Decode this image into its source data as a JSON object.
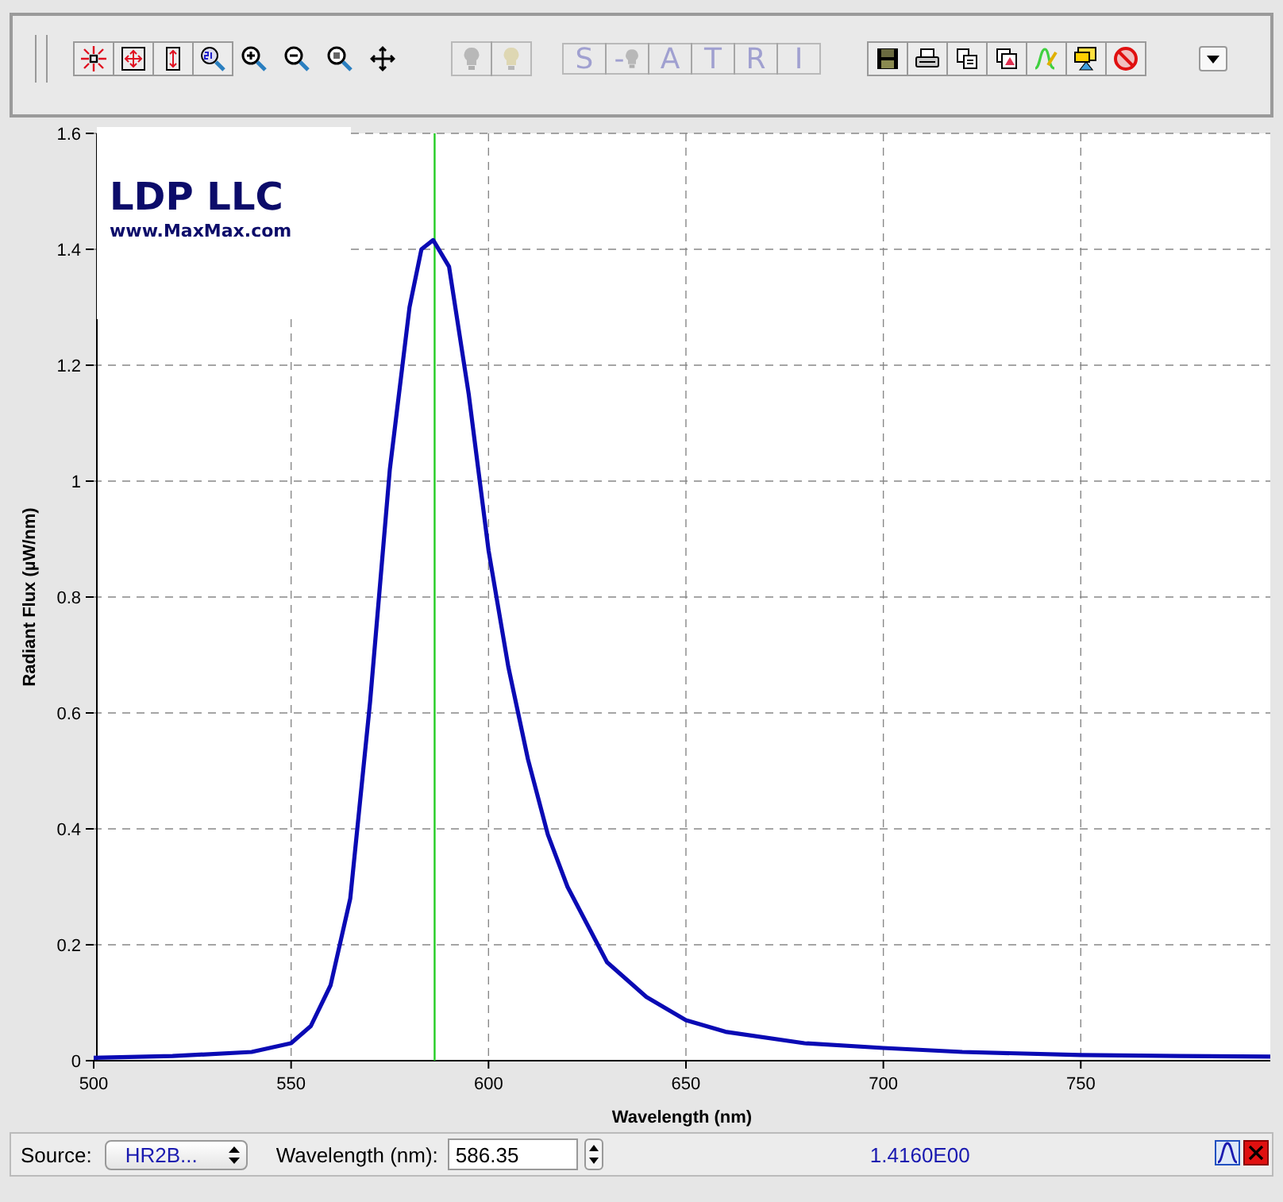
{
  "toolbar": {
    "zoom_buttons": [
      {
        "kind": "crosshair"
      },
      {
        "kind": "expand"
      },
      {
        "kind": "vertical"
      },
      {
        "kind": "zoom-ratio"
      }
    ],
    "view_buttons": [
      {
        "kind": "zoom-in"
      },
      {
        "kind": "zoom-out"
      },
      {
        "kind": "zoom-fit"
      },
      {
        "kind": "pan"
      }
    ],
    "bulb_buttons": [
      {
        "kind": "bulb-grey",
        "disabled": true
      },
      {
        "kind": "bulb-yellow",
        "disabled": true
      }
    ],
    "mode_buttons": [
      {
        "label": "S",
        "disabled": true
      },
      {
        "label": "-",
        "kind": "bulb",
        "disabled": true
      },
      {
        "label": "A",
        "disabled": true
      },
      {
        "label": "T",
        "disabled": true
      },
      {
        "label": "R",
        "disabled": true
      },
      {
        "label": "I",
        "disabled": true
      }
    ],
    "file_buttons": [
      {
        "kind": "save"
      },
      {
        "kind": "print"
      },
      {
        "kind": "copy"
      },
      {
        "kind": "copy-image"
      },
      {
        "kind": "edit-curve"
      },
      {
        "kind": "export"
      },
      {
        "kind": "delete"
      }
    ]
  },
  "logo": {
    "title": "LDP LLC",
    "url": "www.MaxMax.com"
  },
  "chart": {
    "chart_data": {
      "type": "line",
      "xlabel": "Wavelength (nm)",
      "ylabel": "Radiant Flux (µW/nm)",
      "xlim": [
        500,
        798
      ],
      "ylim": [
        0,
        1.6
      ],
      "xticks": [
        500,
        550,
        600,
        650,
        700,
        750
      ],
      "yticks": [
        {
          "value": 0,
          "label": "0"
        },
        {
          "value": 0.2,
          "label": "0.2"
        },
        {
          "value": 0.4,
          "label": "0.4"
        },
        {
          "value": 0.6,
          "label": "0.6"
        },
        {
          "value": 0.8,
          "label": "0.8"
        },
        {
          "value": 1,
          "label": "1"
        },
        {
          "value": 1.2,
          "label": "1.2"
        },
        {
          "value": 1.4,
          "label": "1.4"
        },
        {
          "value": 1.6,
          "label": "1.6"
        }
      ],
      "x": [
        500,
        520,
        540,
        550,
        555,
        560,
        565,
        570,
        575,
        580,
        583,
        586,
        590,
        595,
        600,
        605,
        610,
        615,
        620,
        630,
        640,
        650,
        660,
        680,
        700,
        720,
        750,
        775,
        798
      ],
      "series": [
        {
          "color": "#0a0ab4",
          "values": [
            0.005,
            0.008,
            0.015,
            0.03,
            0.06,
            0.13,
            0.28,
            0.62,
            1.02,
            1.3,
            1.4,
            1.416,
            1.37,
            1.15,
            0.88,
            0.68,
            0.52,
            0.39,
            0.3,
            0.17,
            0.11,
            0.07,
            0.05,
            0.03,
            0.022,
            0.015,
            0.01,
            0.008,
            0.007
          ]
        }
      ],
      "grid": true,
      "ref_lines": [
        {
          "axis": "x",
          "value": 586.35,
          "color": "#22cc22"
        }
      ]
    }
  },
  "status_bar": {
    "source_label": "Source:",
    "source_value": "HR2B...",
    "wavelength_label": "Wavelength (nm):",
    "wavelength_value": "586.35",
    "reading": "1.4160E00"
  }
}
